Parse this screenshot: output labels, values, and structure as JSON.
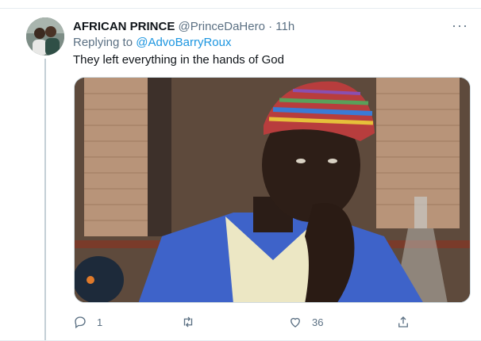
{
  "tweet": {
    "display_name": "AFRICAN PRINCE",
    "handle": "@PrinceDaHero",
    "separator": "·",
    "time": "11h",
    "more": "···",
    "replying_prefix": "Replying to",
    "replying_to": "@AdvoBarryRoux",
    "text": "They left everything in the hands of God"
  },
  "actions": {
    "reply_count": "1",
    "retweet_count": "",
    "like_count": "36"
  },
  "colors": {
    "link": "#1b95e0",
    "secondary": "#5b7083",
    "thread_line": "#c4cfd6"
  },
  "icons": [
    "avatar",
    "more-icon",
    "reply-icon",
    "retweet-icon",
    "like-icon",
    "share-icon"
  ]
}
